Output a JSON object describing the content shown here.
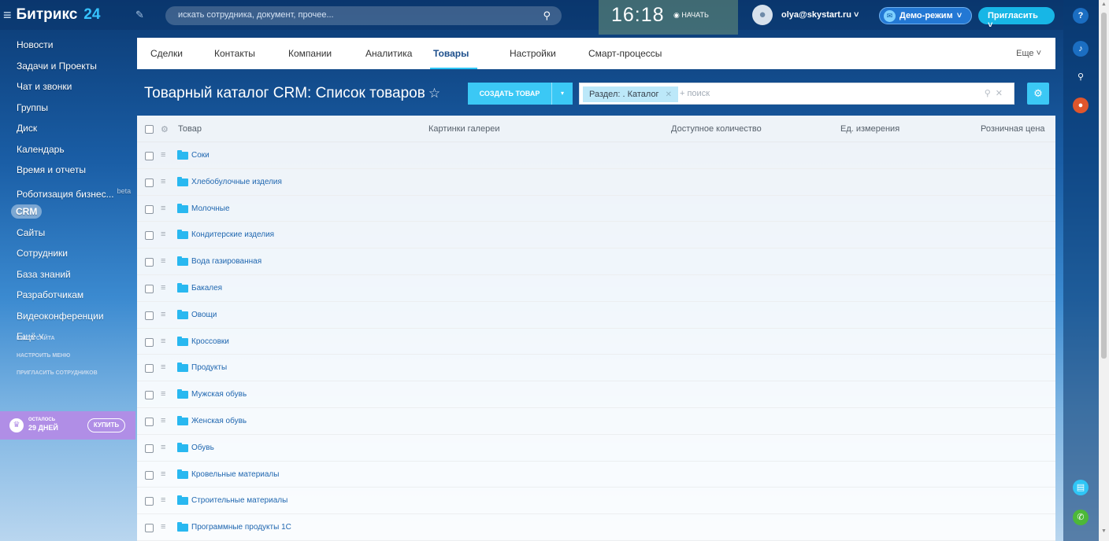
{
  "header": {
    "logo_text": "Битрикс",
    "logo_number": "24",
    "search_placeholder": "искать сотрудника, документ, прочее...",
    "clock": "16:18",
    "start_label": "НАЧАТЬ",
    "user_email": "olya@skystart.ru",
    "demo_label": "Демо-режим",
    "invite_label": "Пригласить"
  },
  "sidebar": {
    "items": [
      {
        "label": "Новости"
      },
      {
        "label": "Задачи и Проекты"
      },
      {
        "label": "Чат и звонки"
      },
      {
        "label": "Группы"
      },
      {
        "label": "Диск"
      },
      {
        "label": "Календарь"
      },
      {
        "label": "Время и отчеты"
      },
      {
        "label": "Роботизация бизнес...",
        "badge": "beta"
      },
      {
        "label": "CRM",
        "active": true
      },
      {
        "label": "Сайты"
      },
      {
        "label": "Сотрудники"
      },
      {
        "label": "База знаний"
      },
      {
        "label": "Разработчикам"
      },
      {
        "label": "Видеоконференции"
      },
      {
        "label": "Ещё"
      }
    ],
    "links": [
      "КАРТА САЙТА",
      "НАСТРОИТЬ МЕНЮ",
      "ПРИГЛАСИТЬ СОТРУДНИКОВ"
    ],
    "trial": {
      "line1": "ОСТАЛОСЬ",
      "line2": "29 ДНЕЙ",
      "buy_label": "КУПИТЬ"
    }
  },
  "tabs": {
    "items": [
      "Сделки",
      "Контакты",
      "Компании",
      "Аналитика",
      "Товары",
      "Настройки",
      "Смарт-процессы"
    ],
    "active": "Товары",
    "more_label": "Еще"
  },
  "page": {
    "title": "Товарный каталог CRM: Список товаров",
    "create_label": "СОЗДАТЬ ТОВАР",
    "filter_chip": "Раздел: . Каталог",
    "filter_placeholder": "+ поиск"
  },
  "grid": {
    "columns": [
      "Товар",
      "Картинки галереи",
      "Доступное количество",
      "Ед. измерения",
      "Розничная цена"
    ],
    "rows": [
      "Соки",
      "Хлебобулочные изделия",
      "Молочные",
      "Кондитерские изделия",
      "Вода газированная",
      "Бакалея",
      "Овощи",
      "Кроссовки",
      "Продукты",
      "Мужская обувь",
      "Женская обувь",
      "Обувь",
      "Кровельные материалы",
      "Строительные материалы",
      "Программные продукты 1С"
    ]
  },
  "colors": {
    "accent": "#3bc8f5",
    "link": "#2067b0",
    "trial": "#b08ee6"
  }
}
